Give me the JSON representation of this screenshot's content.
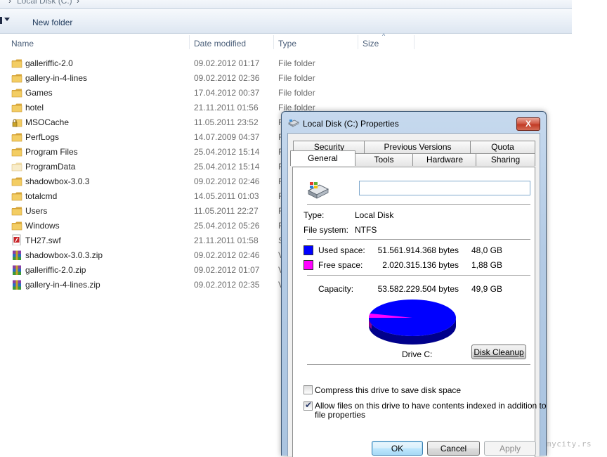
{
  "explorer": {
    "address_crumb": "Local Disk (C:)",
    "toolbar": {
      "new_folder_label": "New folder"
    },
    "columns": {
      "name": "Name",
      "date": "Date modified",
      "type": "Type",
      "size": "Size"
    },
    "rows": [
      {
        "name": "galleriffic-2.0",
        "date": "09.02.2012 01:17",
        "type": "File folder",
        "icon": "folder-icon"
      },
      {
        "name": "gallery-in-4-lines",
        "date": "09.02.2012 02:36",
        "type": "File folder",
        "icon": "folder-icon"
      },
      {
        "name": "Games",
        "date": "17.04.2012 00:37",
        "type": "File folder",
        "icon": "folder-icon"
      },
      {
        "name": "hotel",
        "date": "21.11.2011 01:56",
        "type": "File folder",
        "icon": "folder-icon"
      },
      {
        "name": "MSOCache",
        "date": "11.05.2011 23:52",
        "type": "F",
        "icon": "locked-folder-icon"
      },
      {
        "name": "PerfLogs",
        "date": "14.07.2009 04:37",
        "type": "F",
        "icon": "folder-icon"
      },
      {
        "name": "Program Files",
        "date": "25.04.2012 15:14",
        "type": "F",
        "icon": "folder-icon"
      },
      {
        "name": "ProgramData",
        "date": "25.04.2012 15:14",
        "type": "F",
        "icon": "hidden-folder-icon"
      },
      {
        "name": "shadowbox-3.0.3",
        "date": "09.02.2012 02:46",
        "type": "F",
        "icon": "folder-icon"
      },
      {
        "name": "totalcmd",
        "date": "14.05.2011 01:03",
        "type": "F",
        "icon": "folder-icon"
      },
      {
        "name": "Users",
        "date": "11.05.2011 22:27",
        "type": "F",
        "icon": "folder-icon"
      },
      {
        "name": "Windows",
        "date": "25.04.2012 05:26",
        "type": "F",
        "icon": "folder-icon"
      },
      {
        "name": "TH27.swf",
        "date": "21.11.2011 01:58",
        "type": "S",
        "icon": "swf-file-icon"
      },
      {
        "name": "shadowbox-3.0.3.zip",
        "date": "09.02.2012 02:46",
        "type": "V",
        "icon": "winrar-archive-icon"
      },
      {
        "name": "galleriffic-2.0.zip",
        "date": "09.02.2012 01:07",
        "type": "V",
        "icon": "winrar-archive-icon"
      },
      {
        "name": "gallery-in-4-lines.zip",
        "date": "09.02.2012 02:35",
        "type": "V",
        "icon": "winrar-archive-icon"
      }
    ]
  },
  "dialog": {
    "title": "Local Disk (C:) Properties",
    "close_label": "X",
    "tabs_back": [
      "Security",
      "Previous Versions",
      "Quota"
    ],
    "tabs_front": [
      "General",
      "Tools",
      "Hardware",
      "Sharing"
    ],
    "active_tab": "General",
    "volume_label_value": "",
    "type_label": "Type:",
    "type_value": "Local Disk",
    "fs_label": "File system:",
    "fs_value": "NTFS",
    "used_label": "Used space:",
    "used_bytes": "51.561.914.368 bytes",
    "used_gb": "48,0 GB",
    "free_label": "Free space:",
    "free_bytes": "2.020.315.136 bytes",
    "free_gb": "1,88 GB",
    "capacity_label": "Capacity:",
    "capacity_bytes": "53.582.229.504 bytes",
    "capacity_gb": "49,9 GB",
    "drive_caption": "Drive C:",
    "disk_cleanup_label": "Disk Cleanup",
    "compress_label": "Compress this drive to save disk space",
    "compress_checked": false,
    "index_label_line1": "Allow files on this drive to have contents indexed in addition to",
    "index_label_line2": "file properties",
    "index_checked": true,
    "ok_label": "OK",
    "cancel_label": "Cancel",
    "apply_label": "Apply",
    "colors": {
      "used": "#0000ff",
      "free": "#ff00ff"
    },
    "used_fraction": 0.9623
  },
  "watermark": "mycity.rs"
}
